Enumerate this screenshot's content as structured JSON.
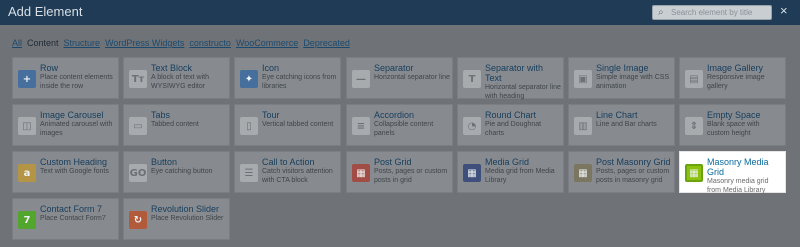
{
  "header": {
    "title": "Add Element",
    "search_placeholder": "Search element by title",
    "close_symbol": "×"
  },
  "tabs": [
    "All",
    "Content",
    "Structure",
    "WordPress Widgets",
    "constructo",
    "WooCommerce",
    "Deprecated"
  ],
  "active_tab": "Content",
  "elements": [
    {
      "name": "Row",
      "desc": "Place content elements inside the row",
      "icon": "grid-plus-icon",
      "glyph": "+",
      "color": "blue"
    },
    {
      "name": "Text Block",
      "desc": "A block of text with WYSIWYG editor",
      "icon": "text-icon",
      "glyph": "Tт",
      "color": "grey"
    },
    {
      "name": "Icon",
      "desc": "Eye catching icons from libraries",
      "icon": "star-icon",
      "glyph": "✦",
      "color": "blue"
    },
    {
      "name": "Separator",
      "desc": "Horizontal separator line",
      "icon": "separator-icon",
      "glyph": "—",
      "color": "grey"
    },
    {
      "name": "Separator with Text",
      "desc": "Horizontal separator line with heading",
      "icon": "separator-text-icon",
      "glyph": "T",
      "color": "grey"
    },
    {
      "name": "Single Image",
      "desc": "Simple image with CSS animation",
      "icon": "image-icon",
      "glyph": "▣",
      "color": "grey"
    },
    {
      "name": "Image Gallery",
      "desc": "Responsive image gallery",
      "icon": "gallery-icon",
      "glyph": "▤",
      "color": "grey"
    },
    {
      "name": "Image Carousel",
      "desc": "Animated carousel with images",
      "icon": "carousel-icon",
      "glyph": "◫",
      "color": "grey"
    },
    {
      "name": "Tabs",
      "desc": "Tabbed content",
      "icon": "tabs-icon",
      "glyph": "▭",
      "color": "grey"
    },
    {
      "name": "Tour",
      "desc": "Vertical tabbed content",
      "icon": "tour-icon",
      "glyph": "▯",
      "color": "grey"
    },
    {
      "name": "Accordion",
      "desc": "Collapsible content panels",
      "icon": "accordion-icon",
      "glyph": "≡",
      "color": "grey"
    },
    {
      "name": "Round Chart",
      "desc": "Pie and Doughnat charts",
      "icon": "round-chart-icon",
      "glyph": "◔",
      "color": "grey"
    },
    {
      "name": "Line Chart",
      "desc": "Line and Bar charts",
      "icon": "line-chart-icon",
      "glyph": "▥",
      "color": "grey"
    },
    {
      "name": "Empty Space",
      "desc": "Blank space with custom height",
      "icon": "empty-space-icon",
      "glyph": "⇕",
      "color": "grey"
    },
    {
      "name": "Custom Heading",
      "desc": "Text with Google fonts",
      "icon": "heading-icon",
      "glyph": "a",
      "color": "gold"
    },
    {
      "name": "Button",
      "desc": "Eye catching button",
      "icon": "button-icon",
      "glyph": "GO",
      "color": "grey"
    },
    {
      "name": "Call to Action",
      "desc": "Catch visitors attention with CTA block",
      "icon": "cta-icon",
      "glyph": "☰",
      "color": "grey"
    },
    {
      "name": "Post Grid",
      "desc": "Posts, pages or custom posts in grid",
      "icon": "post-grid-icon",
      "glyph": "▦",
      "color": "red"
    },
    {
      "name": "Media Grid",
      "desc": "Media grid from Media Library",
      "icon": "media-grid-icon",
      "glyph": "▦",
      "color": "navy"
    },
    {
      "name": "Post Masonry Grid",
      "desc": "Posts, pages or custom posts in masonry grid",
      "icon": "masonry-post-icon",
      "glyph": "▦",
      "color": "olive"
    },
    {
      "name": "Masonry Media Grid",
      "desc": "Masonry media grid from Media Library",
      "icon": "masonry-media-icon",
      "glyph": "▦",
      "color": "bgreen",
      "highlighted": true
    },
    {
      "name": "Contact Form 7",
      "desc": "Place Contact Form7",
      "icon": "contact-form-icon",
      "glyph": "7",
      "color": "green"
    },
    {
      "name": "Revolution Slider",
      "desc": "Place Revolution Slider",
      "icon": "revolution-slider-icon",
      "glyph": "↻",
      "color": "orange"
    }
  ]
}
